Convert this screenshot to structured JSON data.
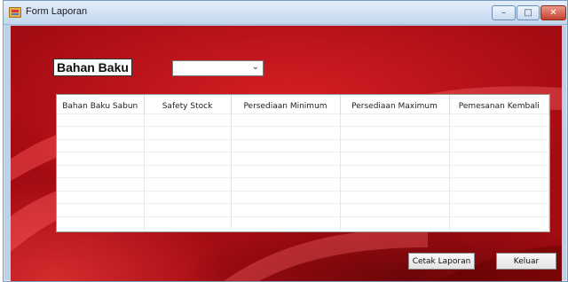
{
  "window": {
    "title": "Form Laporan"
  },
  "titlebar_buttons": {
    "minimize": "–",
    "maximize": "□",
    "close": "✕"
  },
  "form": {
    "label": "Bahan Baku",
    "combo_value": "",
    "combo_arrow": "⌄"
  },
  "grid": {
    "columns": [
      "Bahan Baku Sabun",
      "Safety Stock",
      "Persediaan Minimum",
      "Persediaan Maximum",
      "Pemesanan Kembali"
    ]
  },
  "buttons": {
    "print": "Cetak Laporan",
    "exit": "Keluar"
  },
  "colors": {
    "background_red": "#c4141a",
    "titlebar": "#c2d7ee"
  }
}
